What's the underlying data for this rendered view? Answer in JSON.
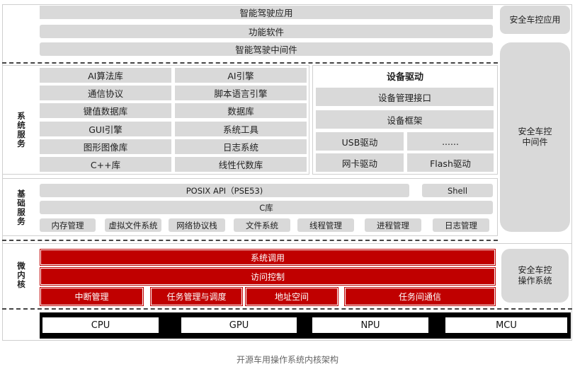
{
  "title": "开源车用操作系统内核架构",
  "colors": {
    "gray_block": "#d9d9d9",
    "kernel_red": "#c00000",
    "hardware_bar": "#000000"
  },
  "application_layer": {
    "rows": [
      "智能驾驶应用",
      "功能软件",
      "智能驾驶中间件"
    ]
  },
  "system_services": {
    "label": "系统服务",
    "left_column": [
      "AI算法库",
      "通信协议",
      "键值数据库",
      "GUI引擎",
      "图形图像库",
      "C++库"
    ],
    "right_column": [
      "AI引擎",
      "脚本语言引擎",
      "数据库",
      "系统工具",
      "日志系统",
      "线性代数库"
    ],
    "device_driver": {
      "title": "设备驱动",
      "rows": [
        "设备管理接口",
        "设备框架"
      ],
      "grid": [
        "USB驱动",
        "......",
        "网卡驱动",
        "Flash驱动"
      ]
    }
  },
  "basic_services": {
    "label": "基础服务",
    "posix": "POSIX API（PSE53)",
    "shell": "Shell",
    "clib": "C库",
    "modules": [
      "内存管理",
      "虚拟文件系统",
      "网络协议栈",
      "文件系统",
      "线程管理",
      "进程管理",
      "日志管理"
    ]
  },
  "microkernel": {
    "label": "微内核",
    "rows": [
      "系统调用",
      "访问控制"
    ],
    "modules": [
      "中断管理",
      "任务管理与调度",
      "地址空间",
      "任务间通信"
    ]
  },
  "hardware": [
    "CPU",
    "GPU",
    "NPU",
    "MCU"
  ],
  "safety": {
    "app": "安全车控应用",
    "middleware": "安全车控中间件",
    "os": "安全车控操作系统"
  }
}
